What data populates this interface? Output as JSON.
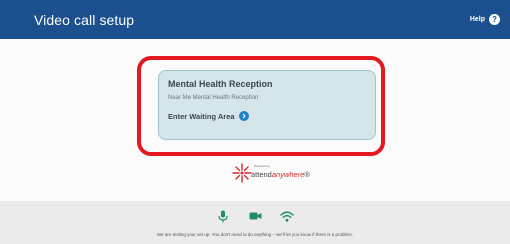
{
  "header": {
    "title": "Video call setup",
    "help_label": "Help",
    "help_icon": "help-circle-icon",
    "background": "#1b4f8e"
  },
  "card": {
    "title": "Mental Health Reception",
    "subtitle": "Near Me Mental Health Reception",
    "enter_label": "Enter Waiting Area",
    "enter_icon": "chevron-right-circle-icon",
    "background": "#d5e6ea",
    "highlight_color": "#e31820"
  },
  "logo": {
    "powered_by": "Powered by",
    "brand_attend": "attend",
    "brand_anywhere": "anywhere",
    "brand_mark": "®"
  },
  "footer": {
    "icons": [
      "microphone-icon",
      "camera-icon",
      "wifi-icon"
    ],
    "icon_color": "#1f8f5f",
    "message": "We are testing your set up. You don't need to do anything – we'll let you know if there is a problem."
  }
}
